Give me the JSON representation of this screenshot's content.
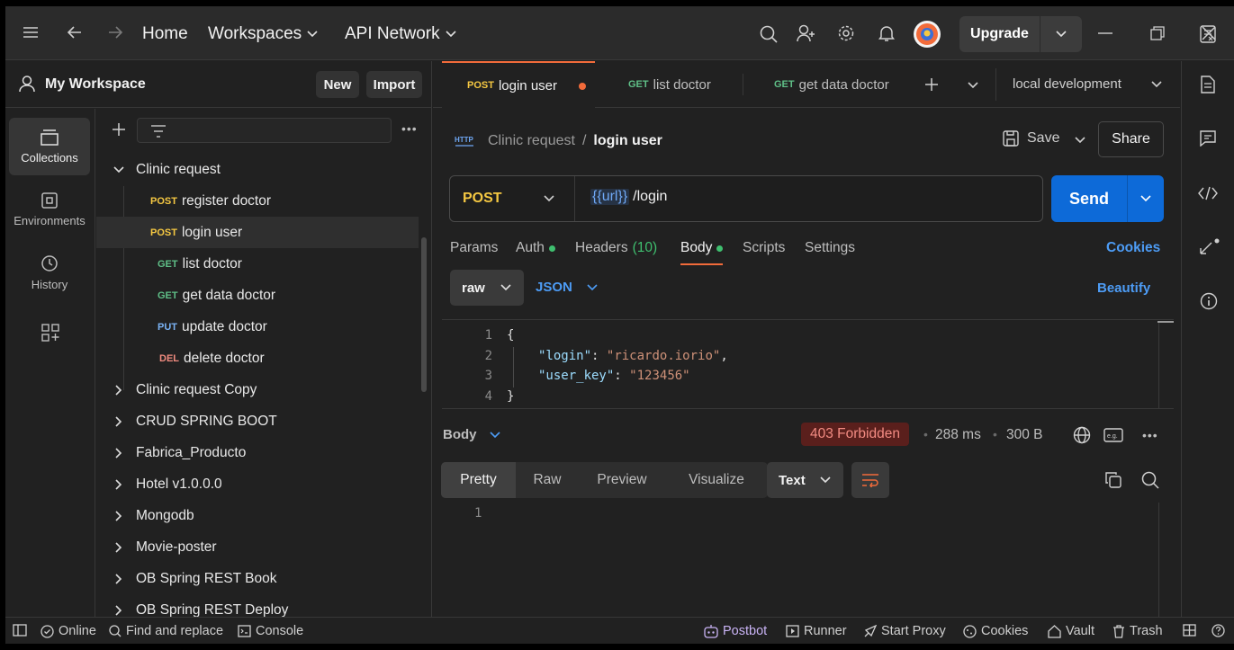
{
  "topbar": {
    "home": "Home",
    "workspaces": "Workspaces",
    "api_network": "API Network",
    "upgrade": "Upgrade"
  },
  "workspace": {
    "title": "My Workspace",
    "new_label": "New",
    "import_label": "Import"
  },
  "rail": [
    {
      "label": "Collections",
      "icon": "collections-icon"
    },
    {
      "label": "Environments",
      "icon": "environments-icon"
    },
    {
      "label": "History",
      "icon": "history-icon"
    }
  ],
  "tree": {
    "collection_open": "Clinic request",
    "requests": [
      {
        "method": "POST",
        "name": "register doctor"
      },
      {
        "method": "POST",
        "name": "login user"
      },
      {
        "method": "GET",
        "name": "list doctor"
      },
      {
        "method": "GET",
        "name": "get data doctor"
      },
      {
        "method": "PUT",
        "name": "update doctor"
      },
      {
        "method": "DEL",
        "name": "delete doctor"
      }
    ],
    "collections": [
      "Clinic request Copy",
      "CRUD SPRING BOOT",
      "Fabrica_Producto",
      "Hotel v1.0.0.0",
      "Mongodb",
      "Movie-poster",
      "OB Spring REST Book",
      "OB Spring REST Deploy"
    ]
  },
  "tabs": [
    {
      "method": "POST",
      "name": "login user"
    },
    {
      "method": "GET",
      "name": "list doctor"
    },
    {
      "method": "GET",
      "name": "get data doctor"
    }
  ],
  "environment": "local development",
  "breadcrumb": {
    "collection": "Clinic request",
    "separator": "/",
    "request": "login user"
  },
  "actions": {
    "save": "Save",
    "share": "Share"
  },
  "request": {
    "method": "POST",
    "url_var": "{{url}}",
    "url_path": "/login",
    "send": "Send"
  },
  "request_tabs": {
    "params": "Params",
    "auth": "Auth",
    "headers": "Headers",
    "headers_count": "(10)",
    "body": "Body",
    "scripts": "Scripts",
    "settings": "Settings",
    "cookies": "Cookies"
  },
  "body_mode": {
    "raw": "raw",
    "json": "JSON",
    "beautify": "Beautify"
  },
  "editor": {
    "line_numbers": [
      "1",
      "2",
      "3",
      "4"
    ],
    "open_brace": "{",
    "key1": "\"login\"",
    "val1": "\"ricardo.iorio\"",
    "key2": "\"user_key\"",
    "val2": "\"123456\"",
    "close_brace": "}",
    "colon": ":",
    "comma": ","
  },
  "response": {
    "label": "Body",
    "status": "403 Forbidden",
    "time": "288 ms",
    "size": "300 B",
    "tabs": [
      "Pretty",
      "Raw",
      "Preview",
      "Visualize"
    ],
    "format": "Text",
    "line1": "1"
  },
  "statusbar": {
    "online": "Online",
    "find_replace": "Find and replace",
    "console": "Console",
    "postbot": "Postbot",
    "runner": "Runner",
    "start_proxy": "Start Proxy",
    "cookies": "Cookies",
    "vault": "Vault",
    "trash": "Trash"
  },
  "colors": {
    "accent_orange": "#f26b3a",
    "send_blue": "#0d6ad8",
    "status_red": "#f28b82",
    "post": "#f5c842",
    "get": "#5fbf87",
    "put": "#7ab3f5",
    "del": "#f08b7f"
  }
}
